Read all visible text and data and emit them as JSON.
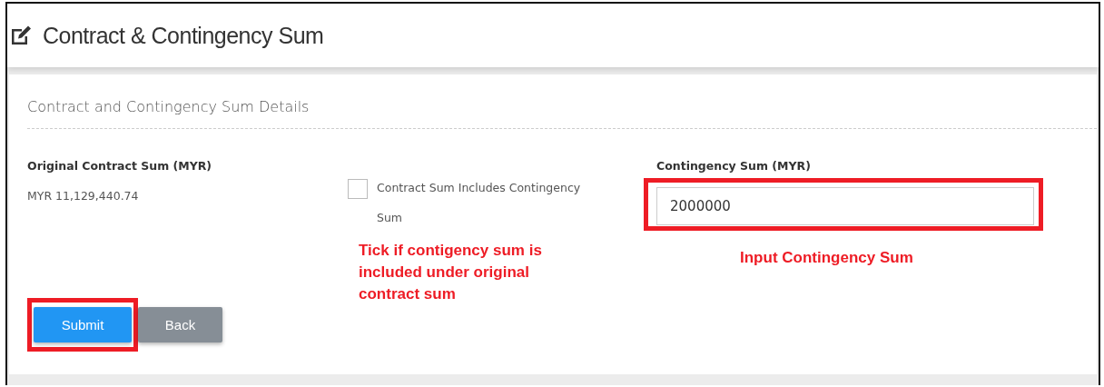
{
  "page": {
    "title": "Contract & Contingency Sum"
  },
  "section": {
    "title": "Contract and Contingency Sum Details"
  },
  "original_contract_sum": {
    "label": "Original Contract Sum (MYR)",
    "value": "MYR 11,129,440.74"
  },
  "includes_contingency": {
    "label": "Contract Sum Includes Contingency Sum",
    "checked": false
  },
  "contingency_sum": {
    "label": "Contingency Sum (MYR)",
    "value": "2000000",
    "highlighted": true
  },
  "buttons": [
    {
      "label": "Submit",
      "kind": "primary",
      "highlighted": true
    },
    {
      "label": "Back",
      "kind": "secondary",
      "highlighted": false
    }
  ],
  "annotations": [
    {
      "text": "Tick if contigency sum is included under original contract sum"
    },
    {
      "text": "Input Contingency Sum"
    }
  ]
}
